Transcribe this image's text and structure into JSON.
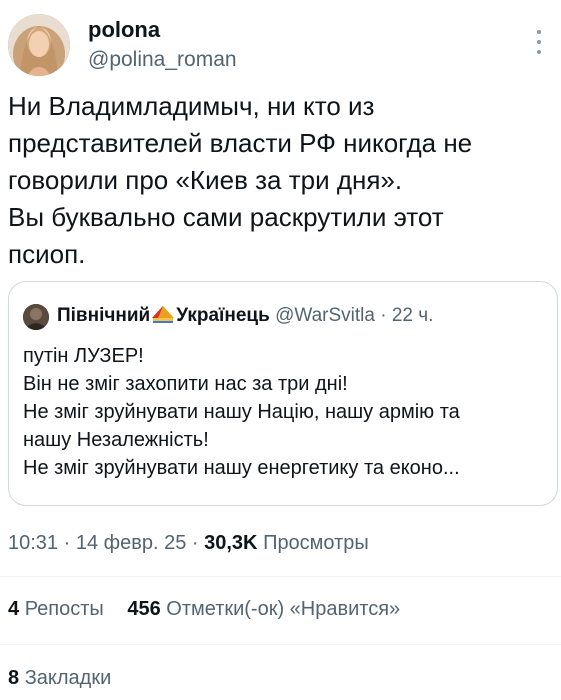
{
  "author": {
    "name": "polona",
    "handle": "@polina_roman"
  },
  "tweet": {
    "lines": [
      "Ни Владимладимыч, ни кто из",
      "представителей власти РФ никогда не",
      "говорили про «Киев за три дня».",
      "Вы буквально сами раскрутили этот",
      "псиоп."
    ]
  },
  "quote": {
    "name_part1": "Північний",
    "name_part2": "Українець",
    "handle": "@WarSvitla",
    "separator": " · ",
    "time": "22 ч.",
    "lines": [
      "путін ЛУЗЕР!",
      "Він не зміг захопити нас за три дні!",
      "Не зміг зруйнувати нашу Націю, нашу армію та",
      "нашу Незалежність!",
      "Не зміг зруйнувати нашу енергетику та еконо..."
    ]
  },
  "meta": {
    "time": "10:31",
    "sep": " · ",
    "date": "14 февр. 25",
    "views_count": "30,3K",
    "views_label": "Просмотры"
  },
  "stats": {
    "reposts_count": "4",
    "reposts_label": "Репосты",
    "likes_count": "456",
    "likes_label": "Отметки(-ок) «Нравится»",
    "bookmarks_count": "8",
    "bookmarks_label": "Закладки"
  },
  "icons": {
    "more": "more-vertical-icon",
    "quote_emoji": "ukraine-flag-emoji"
  },
  "colors": {
    "text": "#0f1419",
    "secondary": "#536471",
    "border": "#cfd9de"
  }
}
